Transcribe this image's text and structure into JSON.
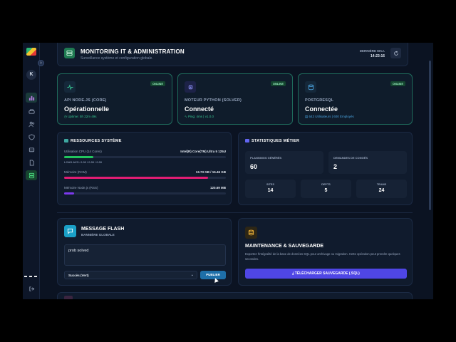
{
  "header": {
    "title": "MONITORING IT & ADMINISTRATION",
    "subtitle": "Surveillance système et configuration globale.",
    "last_label": "DERNIÈRE MAJ.",
    "last_time": "14:23:16"
  },
  "sidebar": {
    "avatar_initial": "K",
    "collapse_glyph": "›",
    "items": [
      "chart-icon",
      "car-icon",
      "users-icon",
      "shield-icon",
      "bus-icon",
      "document-icon",
      "database-icon"
    ]
  },
  "services": [
    {
      "caption": "API NODE.JS (CORE)",
      "state": "Opérationnelle",
      "meta": "Uptime: 5h 22m 49s",
      "badge": "ONLINE"
    },
    {
      "caption": "MOTEUR PYTHON (SOLVER)",
      "state": "Connecté",
      "meta": "Ping: 4ms | v1.0.0",
      "badge": "ONLINE"
    },
    {
      "caption": "POSTGRESQL",
      "state": "Connectée",
      "meta": "643 Utilisateurs | 600 Employés",
      "badge": "ONLINE"
    }
  ],
  "resources": {
    "title": "RESSOURCES SYSTÈME",
    "cpu": {
      "label": "Utilisation CPU (14 Cores)",
      "value": "Intel(R) Core(TM) Ultra 5 125U",
      "load": "LOAD AVG: 0.00 / 0.00 / 0.00",
      "fraction": 0.18
    },
    "ram": {
      "label": "Mémoire (RAM)",
      "value": "13.73 GB / 15.46 GB",
      "fraction": 0.89
    },
    "rss": {
      "label": "Mémoire Node.js (RSS)",
      "value": "120.69 MB",
      "fraction": 0.06
    }
  },
  "stats": {
    "title": "STATISTIQUES MÉTIER",
    "plannings": {
      "label": "PLANNINGS GÉNÉRÉS",
      "value": "60"
    },
    "conges": {
      "label": "DEMANDES DE CONGÉS",
      "value": "2"
    },
    "sites": {
      "label": "SITES",
      "value": "14"
    },
    "depts": {
      "label": "DEPTS",
      "value": "5"
    },
    "teams": {
      "label": "TEAMS",
      "value": "24"
    }
  },
  "flash": {
    "title": "MESSAGE FLASH",
    "subtitle": "BANNIÈRE GLOBALE",
    "message": "prob solved",
    "severity": "Succès (Vert)",
    "publish": "PUBLIER"
  },
  "maintenance": {
    "title": "MAINTENANCE & SAUVEGARDE",
    "description": "Exportez l'intégralité de la base de données SQL pour archivage ou migration. Cette opération peut prendre quelques secondes.",
    "download": "TÉLÉCHARGER SAUVEGARDE (.SQL)"
  },
  "colors": {
    "accent": "#1f7a52",
    "online": "#38c793",
    "cpu": "#22c55e",
    "ram": "#e11d74",
    "rss": "#7c3aed",
    "download": "#4f46e5"
  }
}
